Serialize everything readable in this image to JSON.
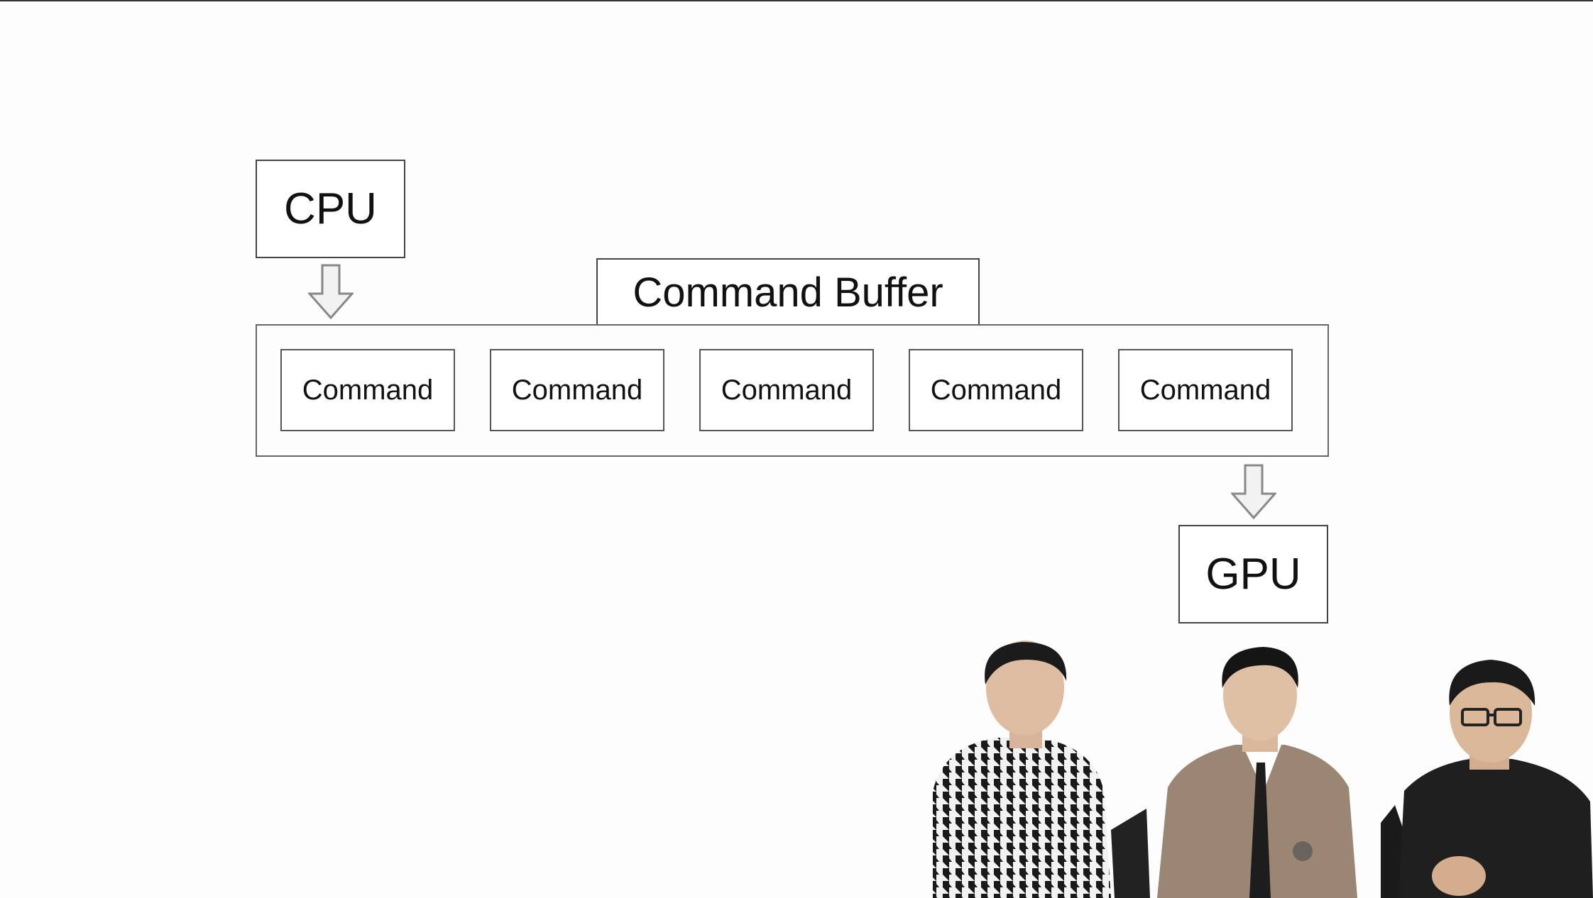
{
  "diagram": {
    "cpu_label": "CPU",
    "buffer_label": "Command Buffer",
    "commands": [
      "Command",
      "Command",
      "Command",
      "Command",
      "Command"
    ],
    "gpu_label": "GPU"
  },
  "video_participants": [
    {
      "shirt": "houndstooth"
    },
    {
      "shirt": "suit"
    },
    {
      "shirt": "black"
    }
  ]
}
